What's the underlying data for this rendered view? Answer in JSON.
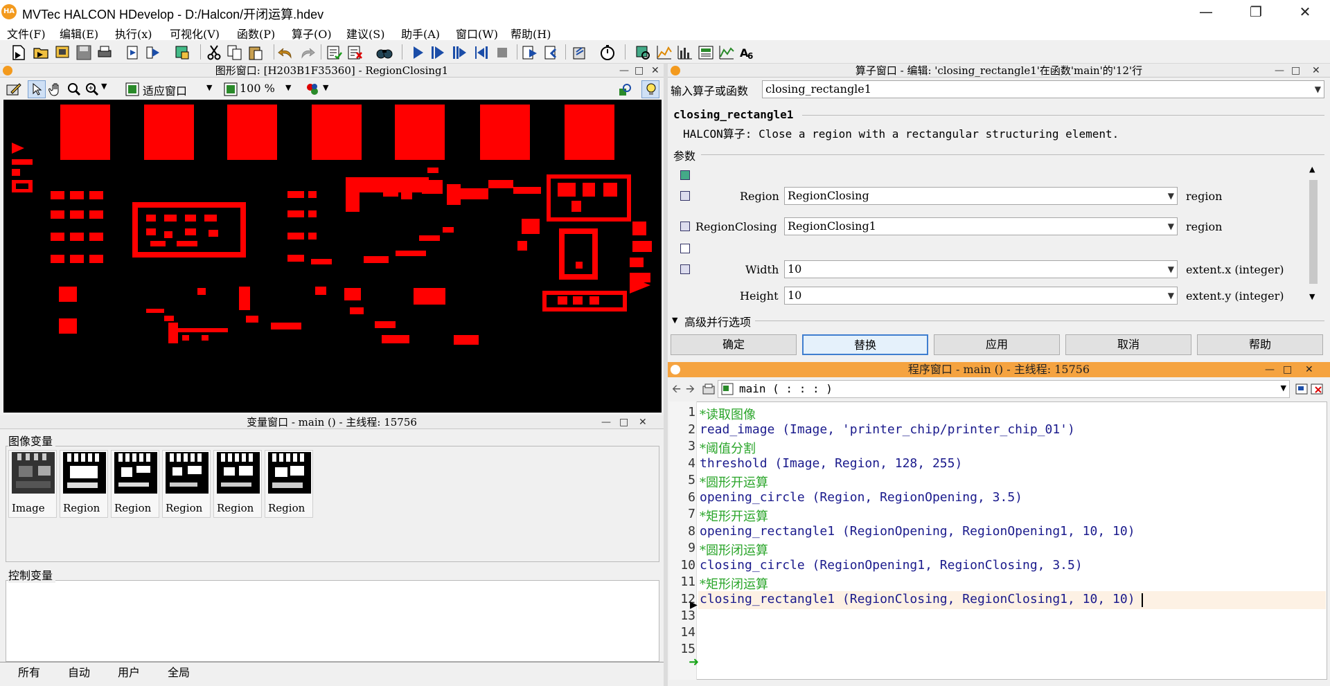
{
  "title": "MVTec HALCON HDevelop - D:/Halcon/开闭运算.hdev",
  "app_icon": "HA",
  "menu": [
    "文件(F)",
    "编辑(E)",
    "执行(x)",
    "可视化(V)",
    "函数(P)",
    "算子(O)",
    "建议(S)",
    "助手(A)",
    "窗口(W)",
    "帮助(H)"
  ],
  "graphics": {
    "title": "图形窗口: [H203B1F35360] - RegionClosing1",
    "zoom_mode": "适应窗口",
    "zoom_percent": "100 %"
  },
  "variables": {
    "title": "变量窗口 - main () - 主线程: 15756",
    "image_vars_label": "图像变量",
    "image_vars": [
      "Image",
      "Region",
      "Region",
      "Region",
      "Region",
      "Region"
    ],
    "control_vars_label": "控制变量",
    "tabs": [
      "所有",
      "自动",
      "用户",
      "全局"
    ]
  },
  "operator": {
    "title": "算子窗口 - 编辑: 'closing_rectangle1'在函数'main'的'12'行",
    "input_label": "输入算子或函数",
    "input_value": "closing_rectangle1",
    "op_name": "closing_rectangle1",
    "description": "HALCON算子: Close a region with a rectangular structuring element.",
    "params_label": "参数",
    "params": [
      {
        "name": "Region",
        "value": "RegionClosing",
        "type": "region"
      },
      {
        "name": "RegionClosing",
        "value": "RegionClosing1",
        "type": "region"
      },
      {
        "name": "Width",
        "value": "10",
        "type": "extent.x (integer)"
      },
      {
        "name": "Height",
        "value": "10",
        "type": "extent.y (integer)"
      }
    ],
    "advanced_label": "高级并行选项",
    "buttons": [
      "确定",
      "替换",
      "应用",
      "取消",
      "帮助"
    ]
  },
  "program": {
    "title": "程序窗口 - main () - 主线程: 15756",
    "procedure": "main ( : : : )",
    "lines": [
      {
        "n": "1",
        "text": "*读取图像",
        "kind": "comment"
      },
      {
        "n": "2",
        "text": "read_image (Image, 'printer_chip/printer_chip_01')",
        "kind": "code"
      },
      {
        "n": "3",
        "text": "*阈值分割",
        "kind": "comment"
      },
      {
        "n": "4",
        "text": "threshold (Image, Region, 128, 255)",
        "kind": "code"
      },
      {
        "n": "5",
        "text": "*圆形开运算",
        "kind": "comment"
      },
      {
        "n": "6",
        "text": "opening_circle (Region, RegionOpening, 3.5)",
        "kind": "code"
      },
      {
        "n": "7",
        "text": "*矩形开运算",
        "kind": "comment"
      },
      {
        "n": "8",
        "text": "opening_rectangle1 (RegionOpening, RegionOpening1, 10, 10)",
        "kind": "code"
      },
      {
        "n": "9",
        "text": "*圆形闭运算",
        "kind": "comment"
      },
      {
        "n": "10",
        "text": "closing_circle (RegionOpening1, RegionClosing, 3.5)",
        "kind": "code"
      },
      {
        "n": "11",
        "text": "*矩形闭运算",
        "kind": "comment"
      },
      {
        "n": "12",
        "text": "closing_rectangle1 (RegionClosing, RegionClosing1, 10, 10)",
        "kind": "code"
      },
      {
        "n": "13",
        "text": "",
        "kind": "code"
      },
      {
        "n": "14",
        "text": "",
        "kind": "code"
      },
      {
        "n": "15",
        "text": "",
        "kind": "code"
      }
    ]
  },
  "colors": {
    "region_red": "#ff0000",
    "program_title": "#f5a340",
    "comment_green": "#2aa52a",
    "code_blue": "#1a1a8c"
  }
}
